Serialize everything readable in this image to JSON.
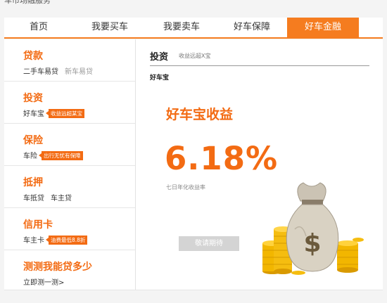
{
  "header": {
    "partial_text": "车市场融服务"
  },
  "nav": {
    "tabs": [
      {
        "label": "首页"
      },
      {
        "label": "我要买车"
      },
      {
        "label": "我要卖车"
      },
      {
        "label": "好车保障"
      },
      {
        "label": "好车金融"
      }
    ],
    "active_index": 4
  },
  "sidebar": {
    "items": [
      {
        "title": "贷款",
        "subs": [
          "二手车易贷",
          "新车易贷"
        ]
      },
      {
        "title": "投资",
        "sub": "好车宝",
        "tag": "收益远超某宝"
      },
      {
        "title": "保险",
        "sub": "车险",
        "tag": "出行无忧有保障"
      },
      {
        "title": "抵押",
        "subs": [
          "车抵贷",
          "车主贷"
        ]
      },
      {
        "title": "信用卡",
        "sub": "车主卡",
        "tag": "油费最低8.8折"
      },
      {
        "title": "测测我能贷多少",
        "sub": "立即测一测>"
      }
    ]
  },
  "content": {
    "title": "投资",
    "subtitle": "收益远超X宝",
    "tab": "好车宝",
    "headline": "好车宝收益",
    "rate": "6.18%",
    "rate_label": "七日年化收益率",
    "button": "敬请期待"
  },
  "colors": {
    "accent": "#f36b13",
    "nav_active": "#f57c1f",
    "button_disabled": "#d4d4d4",
    "gold": "#f2b600"
  },
  "icons": [
    "money-bag-icon",
    "gold-coins-icon"
  ]
}
